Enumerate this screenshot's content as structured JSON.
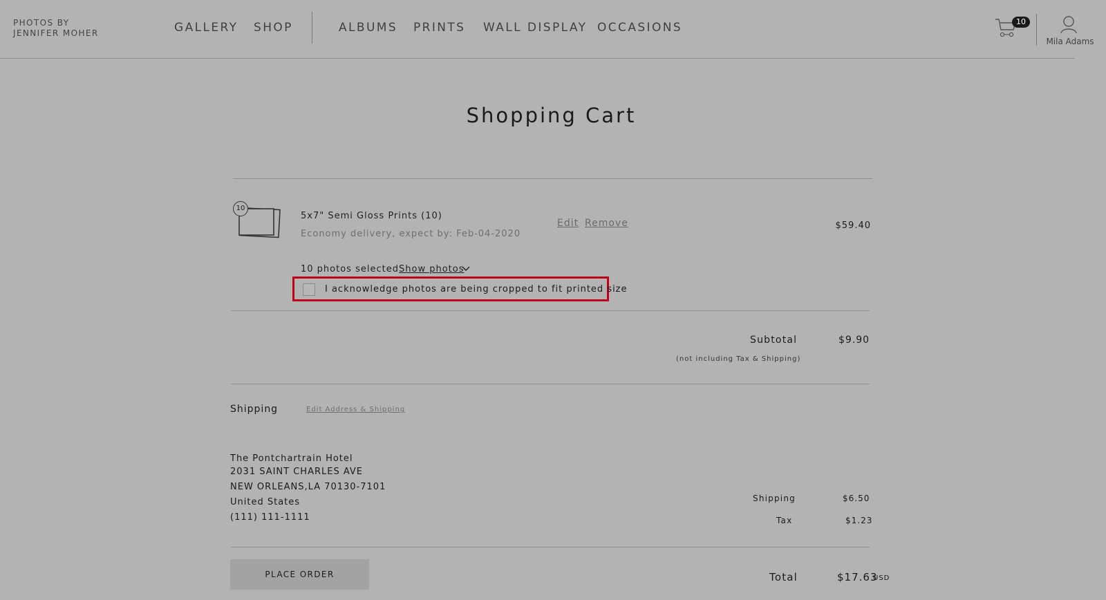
{
  "header": {
    "logo_line1": "PHOTOS BY",
    "logo_line2": "JENNIFER MOHER",
    "nav": {
      "gallery": "GALLERY",
      "shop": "SHOP",
      "albums": "ALBUMS",
      "prints": "PRINTS",
      "wall_display": "WALL DISPLAY",
      "occasions": "OCCASIONS"
    },
    "cart_count": "10",
    "user_name": "Mila Adams"
  },
  "page_title": "Shopping Cart",
  "cart_item": {
    "quantity_badge": "10",
    "name": "5x7\" Semi Gloss Prints (10)",
    "delivery": "Economy delivery, expect by: Feb-04-2020",
    "edit_label": "Edit",
    "remove_label": "Remove",
    "price": "$59.40",
    "photos_selected": "10 photos selected",
    "show_photos_label": "Show photos",
    "acknowledge_label": "I acknowledge photos are being cropped to fit printed size",
    "acknowledge_checked": false
  },
  "summary": {
    "subtotal_label": "Subtotal",
    "subtotal_value": "$9.90",
    "subtotal_note": "(not including Tax & Shipping)",
    "shipping_label": "Shipping",
    "shipping_value": "$6.50",
    "tax_label": "Tax",
    "tax_value": "$1.23",
    "total_label": "Total",
    "total_value": "$17.63",
    "currency": "USD"
  },
  "shipping": {
    "title": "Shipping",
    "edit_label": "Edit Address & Shipping",
    "address_lines": [
      "The Pontchartrain Hotel",
      "2031 SAINT CHARLES AVE",
      "NEW ORLEANS,LA 70130-7101",
      "United States",
      "(111) 111-1111"
    ]
  },
  "actions": {
    "place_order_label": "PLACE ORDER"
  },
  "colors": {
    "background": "#b3b3b3",
    "highlight_border": "#c1001a",
    "text": "#1a1a1a",
    "muted_text": "#6f6f6f"
  }
}
